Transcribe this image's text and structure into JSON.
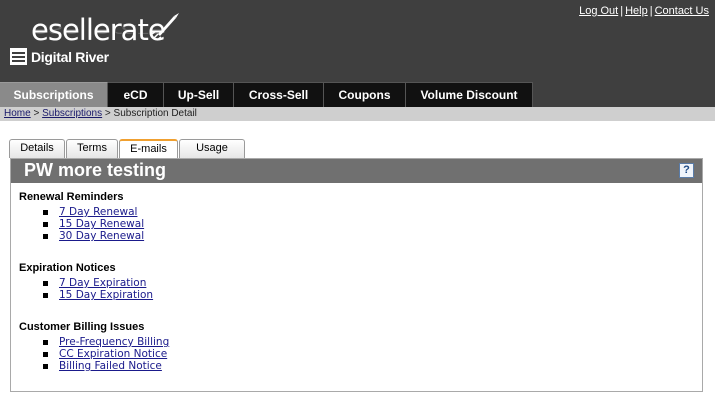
{
  "brand": {
    "logo_text": "esellerate",
    "company": "Digital River"
  },
  "top_links": [
    "Log Out",
    "Help",
    "Contact Us"
  ],
  "nav": {
    "items": [
      "Subscriptions",
      "eCD",
      "Up-Sell",
      "Cross-Sell",
      "Coupons",
      "Volume Discount"
    ],
    "active": "Subscriptions"
  },
  "breadcrumb": {
    "home": "Home",
    "sep1": ">",
    "subscriptions": "Subscriptions",
    "sep2": ">",
    "current": "Subscription Detail"
  },
  "tabs": {
    "items": [
      "Details",
      "Terms",
      "E-mails",
      "Usage"
    ],
    "active": "E-mails"
  },
  "panel": {
    "title": "PW more testing",
    "help_label": "?"
  },
  "sections": [
    {
      "heading": "Renewal Reminders",
      "links": [
        "7 Day Renewal",
        "15 Day Renewal",
        "30 Day Renewal"
      ]
    },
    {
      "heading": "Expiration Notices",
      "links": [
        "7 Day Expiration",
        "15 Day Expiration"
      ]
    },
    {
      "heading": "Customer Billing Issues",
      "links": [
        "Pre-Frequency Billing",
        "CC Expiration Notice",
        "Billing Failed Notice"
      ]
    }
  ],
  "colors": {
    "header_bg": "#3f3f3f",
    "nav_bg": "#111111",
    "nav_active_bg": "#8a8a8a",
    "breadcrumb_bg": "#cfcfcf",
    "panel_title_bg": "#707070",
    "link": "#1a1a8b",
    "tab_active_accent": "#f0a030"
  }
}
